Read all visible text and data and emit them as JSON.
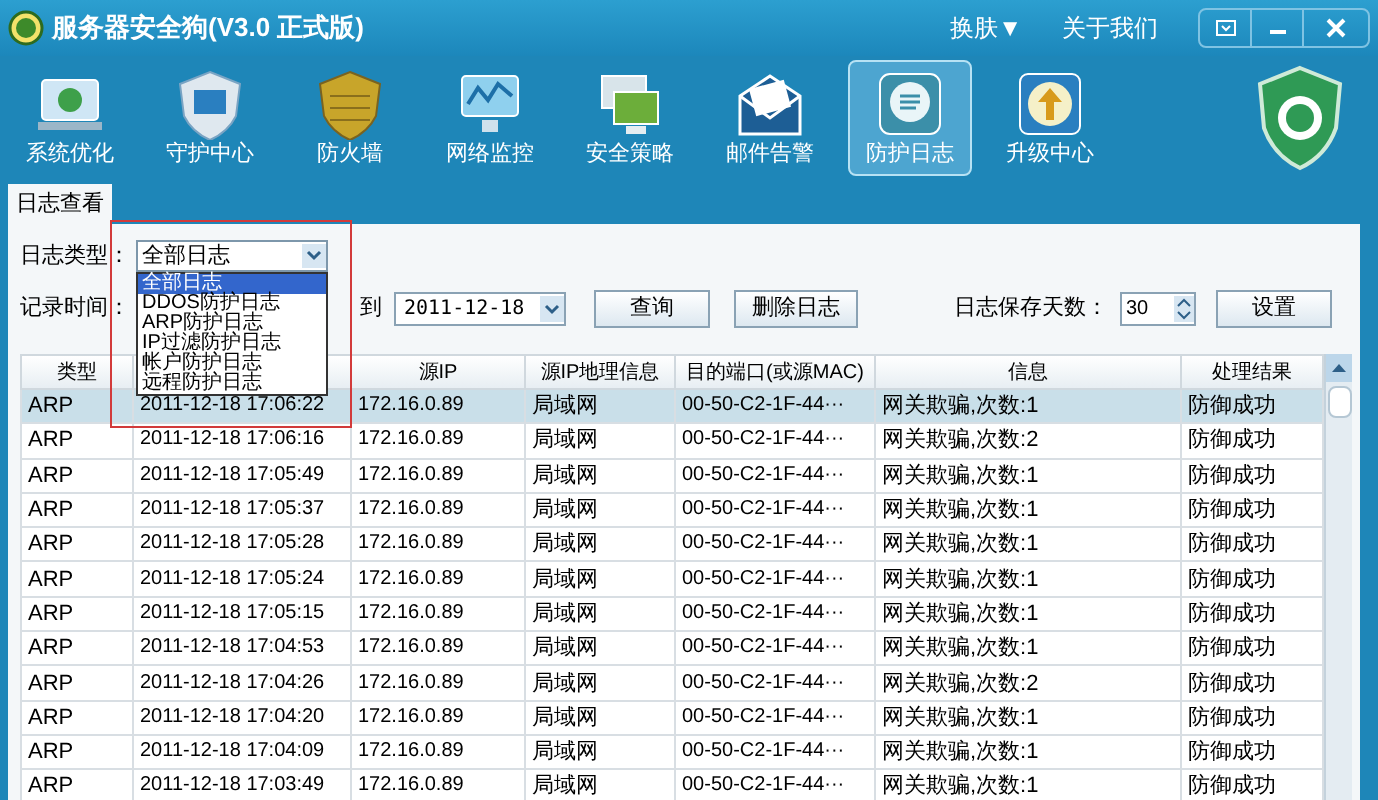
{
  "window": {
    "title": "服务器安全狗(V3.0 正式版)",
    "skin_menu": "换肤▼",
    "about": "关于我们"
  },
  "nav": [
    {
      "label": "系统优化",
      "selected": false
    },
    {
      "label": "守护中心",
      "selected": false
    },
    {
      "label": "防火墙",
      "selected": false
    },
    {
      "label": "网络监控",
      "selected": false
    },
    {
      "label": "安全策略",
      "selected": false
    },
    {
      "label": "邮件告警",
      "selected": false
    },
    {
      "label": "防护日志",
      "selected": true
    },
    {
      "label": "升级中心",
      "selected": false
    }
  ],
  "tabs": [
    {
      "label": "日志查看",
      "selected": true
    }
  ],
  "filters": {
    "type_label": "日志类型：",
    "type_value": "全部日志",
    "time_label": "记录时间：",
    "to_label": "到",
    "end_date": "2011-12-18",
    "query_button": "查询",
    "delete_button": "删除日志",
    "keep_days_label": "日志保存天数：",
    "keep_days": "30",
    "set_button": "设置"
  },
  "dropdown_options": [
    {
      "label": "全部日志",
      "selected": true
    },
    {
      "label": "DDOS防护日志",
      "selected": false
    },
    {
      "label": "ARP防护日志",
      "selected": false
    },
    {
      "label": "IP过滤防护日志",
      "selected": false
    },
    {
      "label": "帐户防护日志",
      "selected": false
    },
    {
      "label": "远程防护日志",
      "selected": false
    }
  ],
  "table": {
    "columns": [
      "类型",
      "",
      "源IP",
      "源IP地理信息",
      "目的端口(或源MAC)",
      "信息",
      "处理结果"
    ],
    "rows": [
      {
        "cells": [
          "ARP",
          "2011-12-18 17:06:22",
          "172.16.0.89",
          "局域网",
          "00-50-C2-1F-44···",
          "网关欺骗,次数:1",
          "防御成功"
        ],
        "selected": true
      },
      {
        "cells": [
          "ARP",
          "2011-12-18 17:06:16",
          "172.16.0.89",
          "局域网",
          "00-50-C2-1F-44···",
          "网关欺骗,次数:2",
          "防御成功"
        ],
        "selected": false
      },
      {
        "cells": [
          "ARP",
          "2011-12-18 17:05:49",
          "172.16.0.89",
          "局域网",
          "00-50-C2-1F-44···",
          "网关欺骗,次数:1",
          "防御成功"
        ],
        "selected": false
      },
      {
        "cells": [
          "ARP",
          "2011-12-18 17:05:37",
          "172.16.0.89",
          "局域网",
          "00-50-C2-1F-44···",
          "网关欺骗,次数:1",
          "防御成功"
        ],
        "selected": false
      },
      {
        "cells": [
          "ARP",
          "2011-12-18 17:05:28",
          "172.16.0.89",
          "局域网",
          "00-50-C2-1F-44···",
          "网关欺骗,次数:1",
          "防御成功"
        ],
        "selected": false
      },
      {
        "cells": [
          "ARP",
          "2011-12-18 17:05:24",
          "172.16.0.89",
          "局域网",
          "00-50-C2-1F-44···",
          "网关欺骗,次数:1",
          "防御成功"
        ],
        "selected": false
      },
      {
        "cells": [
          "ARP",
          "2011-12-18 17:05:15",
          "172.16.0.89",
          "局域网",
          "00-50-C2-1F-44···",
          "网关欺骗,次数:1",
          "防御成功"
        ],
        "selected": false
      },
      {
        "cells": [
          "ARP",
          "2011-12-18 17:04:53",
          "172.16.0.89",
          "局域网",
          "00-50-C2-1F-44···",
          "网关欺骗,次数:1",
          "防御成功"
        ],
        "selected": false
      },
      {
        "cells": [
          "ARP",
          "2011-12-18 17:04:26",
          "172.16.0.89",
          "局域网",
          "00-50-C2-1F-44···",
          "网关欺骗,次数:2",
          "防御成功"
        ],
        "selected": false
      },
      {
        "cells": [
          "ARP",
          "2011-12-18 17:04:20",
          "172.16.0.89",
          "局域网",
          "00-50-C2-1F-44···",
          "网关欺骗,次数:1",
          "防御成功"
        ],
        "selected": false
      },
      {
        "cells": [
          "ARP",
          "2011-12-18 17:04:09",
          "172.16.0.89",
          "局域网",
          "00-50-C2-1F-44···",
          "网关欺骗,次数:1",
          "防御成功"
        ],
        "selected": false
      },
      {
        "cells": [
          "ARP",
          "2011-12-18 17:03:49",
          "172.16.0.89",
          "局域网",
          "00-50-C2-1F-44···",
          "网关欺骗,次数:1",
          "防御成功"
        ],
        "selected": false
      }
    ]
  }
}
